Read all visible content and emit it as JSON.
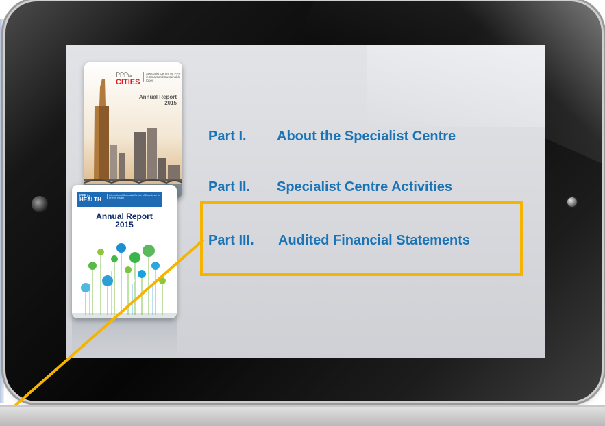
{
  "colors": {
    "toc_text": "#1b74b5",
    "highlight": "#f4b400",
    "health_blue": "#1f6bb3",
    "cities_red": "#e21b23"
  },
  "cover_cities": {
    "logo_prefix": "PPP",
    "logo_for": "for",
    "logo_word": "CITIES",
    "logo_desc": "Specialist Centre on PPP in Smart and Sustainable Cities",
    "title": "Annual Report",
    "year": "2015",
    "image": "city-skyline-illustration"
  },
  "cover_health": {
    "logo_prefix": "PPP in",
    "logo_word": "HEALTH",
    "logo_desc": "International Specialist Centre of Excellence for PPP in Health",
    "title": "Annual Report",
    "year": "2015",
    "image": "health-icon-tree-illustration"
  },
  "toc": [
    {
      "number": "Part I.",
      "title": "About the Specialist Centre"
    },
    {
      "number": "Part II.",
      "title": "Specialist Centre Activities"
    },
    {
      "number": "Part III.",
      "title": "Audited Financial Statements"
    }
  ],
  "icons": {
    "camera": "camera-icon",
    "home": "home-button-icon"
  }
}
